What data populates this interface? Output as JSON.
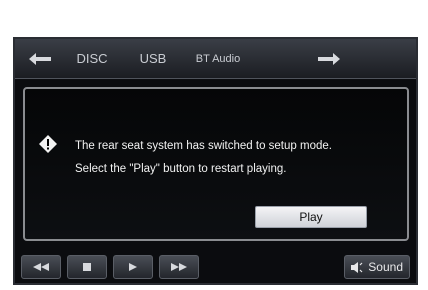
{
  "topbar": {
    "back_icon": "arrow-left-icon",
    "tabs": [
      {
        "label": "DISC"
      },
      {
        "label": "USB"
      },
      {
        "label": "BT Audio"
      }
    ],
    "forward_icon": "arrow-right-icon"
  },
  "dialog": {
    "icon": "warning-diamond-icon",
    "message_line1": "The rear seat system has switched to setup mode.",
    "message_line2": "Select the \"Play\" button to restart playing.",
    "play_label": "Play"
  },
  "controls": {
    "rewind_icon": "rewind-icon",
    "stop_icon": "stop-icon",
    "play_icon": "play-icon",
    "fast_forward_icon": "fast-forward-icon",
    "sound_label": "Sound",
    "sound_icon": "speaker-icon"
  }
}
